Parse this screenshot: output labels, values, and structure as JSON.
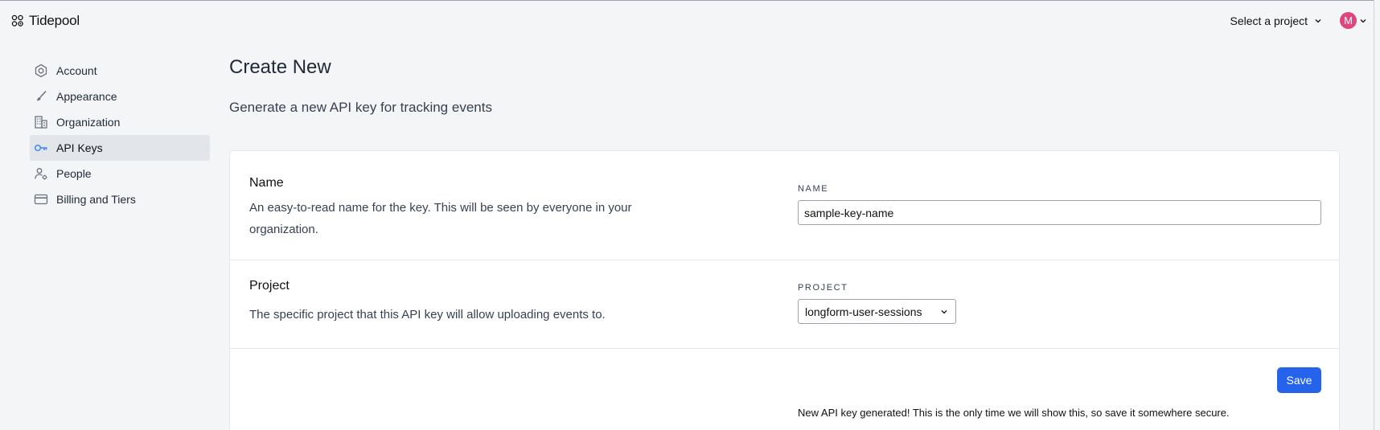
{
  "header": {
    "brand_name": "Tidepool",
    "project_select_label": "Select a project",
    "avatar_initial": "M",
    "avatar_color": "#e0457b"
  },
  "sidebar": {
    "items": [
      {
        "label": "Account",
        "icon": "account-icon",
        "active": false
      },
      {
        "label": "Appearance",
        "icon": "brush-icon",
        "active": false
      },
      {
        "label": "Organization",
        "icon": "building-icon",
        "active": false
      },
      {
        "label": "API Keys",
        "icon": "key-icon",
        "active": true
      },
      {
        "label": "People",
        "icon": "people-icon",
        "active": false
      },
      {
        "label": "Billing and Tiers",
        "icon": "credit-card-icon",
        "active": false
      }
    ]
  },
  "main": {
    "title": "Create New",
    "subtitle": "Generate a new API key for tracking events",
    "name_section": {
      "title": "Name",
      "description": "An easy-to-read name for the key. This will be seen by everyone in your organization.",
      "field_label": "NAME",
      "field_value": "sample-key-name"
    },
    "project_section": {
      "title": "Project",
      "description": "The specific project that this API key will allow uploading events to.",
      "field_label": "PROJECT",
      "selected_value": "longform-user-sessions"
    },
    "save_label": "Save",
    "notice": "New API key generated! This is the only time we will show this, so save it somewhere secure."
  },
  "colors": {
    "accent": "#2563eb",
    "active_nav_bg": "#e2e5e9",
    "active_icon": "#3b82f6"
  }
}
